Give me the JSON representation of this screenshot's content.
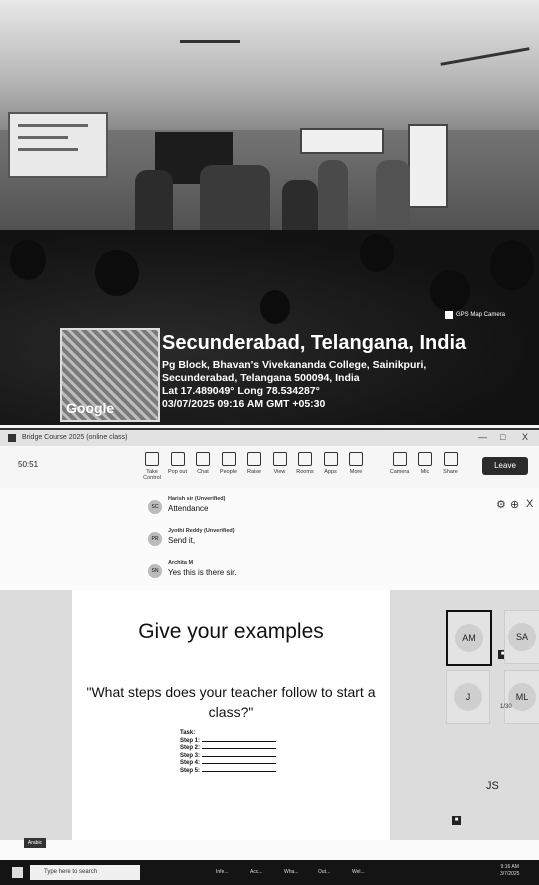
{
  "photo": {
    "camera_tag": "GPS Map Camera",
    "geo": {
      "map_label": "Google",
      "title": "Secunderabad, Telangana, India",
      "address_line1": "Pg Block, Bhavan's Vivekananda College, Sainikpuri,",
      "address_line2": "Secunderabad, Telangana 500094, India",
      "coords": "Lat 17.489049° Long 78.534287°",
      "datetime": "03/07/2025 09:16 AM GMT +05:30"
    }
  },
  "app": {
    "window_title": "Bridge Course 2025 (online class)",
    "window_controls": [
      "—",
      "□",
      "X"
    ],
    "timer": "50:51",
    "toolbar": [
      {
        "label": "Take Control",
        "icon": "take-control-icon"
      },
      {
        "label": "Pop out",
        "icon": "pop-out-icon"
      },
      {
        "label": "Chat",
        "icon": "chat-icon"
      },
      {
        "label": "People",
        "icon": "people-icon"
      },
      {
        "label": "Raise",
        "icon": "raise-hand-icon"
      },
      {
        "label": "View",
        "icon": "view-icon"
      },
      {
        "label": "Rooms",
        "icon": "rooms-icon"
      },
      {
        "label": "Apps",
        "icon": "apps-icon"
      },
      {
        "label": "More",
        "icon": "more-icon"
      },
      {
        "label": "Camera",
        "icon": "camera-icon"
      },
      {
        "label": "Mic",
        "icon": "mic-icon"
      },
      {
        "label": "Share",
        "icon": "share-icon"
      }
    ],
    "leave_label": "Leave",
    "chat_messages": [
      {
        "initials": "SC",
        "name": "Harish sir (Unverified)",
        "text": "Attendance"
      },
      {
        "initials": "PR",
        "name": "Jyothi Reddy (Unverified)",
        "text": "Send it,"
      },
      {
        "initials": "SN",
        "name": "Archita M",
        "text": "Yes this is there sir."
      }
    ],
    "slide": {
      "title": "Give your examples",
      "question": "\"What steps does your teacher follow to start a class?\"",
      "task_heading": "Task:",
      "steps": [
        "Step 1:",
        "Step 2:",
        "Step 3:",
        "Step 4:",
        "Step 5:"
      ]
    },
    "participants": [
      {
        "initials": "AM",
        "active": true
      },
      {
        "initials": "SA",
        "active": false
      },
      {
        "initials": "J",
        "active": false
      },
      {
        "initials": "ML",
        "active": false
      }
    ],
    "page_indicator": "1/30",
    "bottom_participant": "JS",
    "corner_tag": "Arabic"
  },
  "taskbar": {
    "search_placeholder": "Type here to search",
    "apps": [
      "Infe...",
      "Acc...",
      "Wha...",
      "Out...",
      "Wel..."
    ],
    "time": "9:16 AM",
    "date": "3/7/2025"
  }
}
